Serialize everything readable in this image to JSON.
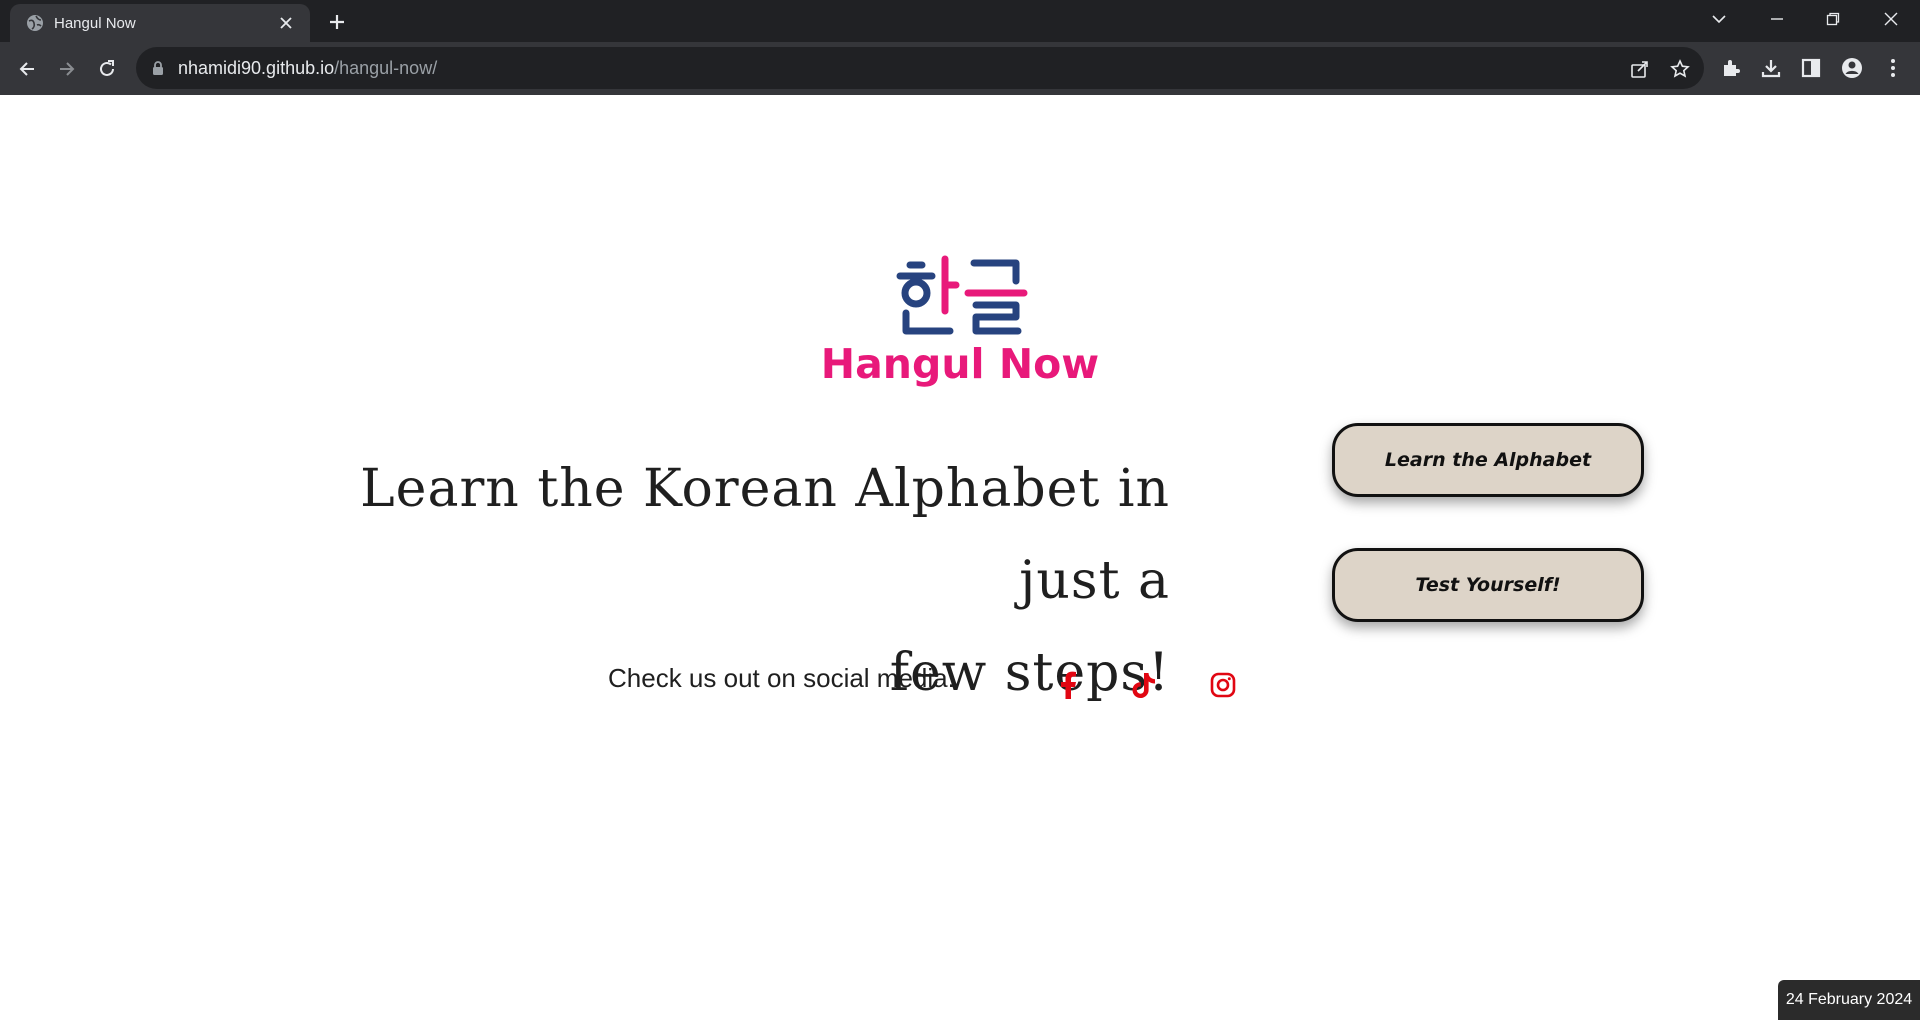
{
  "browser": {
    "tab_title": "Hangul Now",
    "url_domain": "nhamidi90.github.io",
    "url_path": "/hangul-now/"
  },
  "logo": {
    "hangul": "한글",
    "name": "Hangul Now",
    "brand_pink": "#e8197a",
    "brand_blue": "#27437f"
  },
  "hero": {
    "headline_line1": "Learn the Korean Alphabet in just a",
    "headline_line2": "few steps!"
  },
  "buttons": {
    "learn_label": "Learn the Alphabet",
    "test_label": "Test Yourself!"
  },
  "social": {
    "label": "Check us out on social media:",
    "icons": [
      "facebook-icon",
      "tiktok-icon",
      "instagram-icon"
    ],
    "icon_color": "#e10612"
  },
  "overlay": {
    "date": "24 February 2024"
  }
}
